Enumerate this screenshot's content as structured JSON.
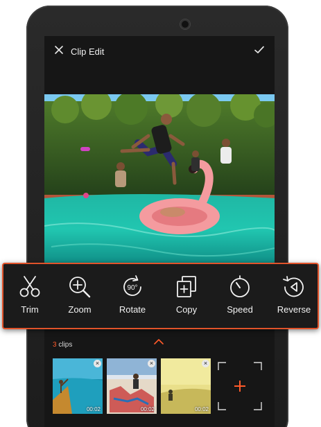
{
  "header": {
    "title": "Clip Edit",
    "close_icon": "close-icon",
    "confirm_icon": "checkmark-icon"
  },
  "toolbar": {
    "accent_color": "#e1532a",
    "items": [
      {
        "label": "Trim",
        "icon": "scissors-icon"
      },
      {
        "label": "Zoom",
        "icon": "zoom-in-icon"
      },
      {
        "label": "Rotate",
        "icon": "rotate-icon",
        "badge": "90°"
      },
      {
        "label": "Copy",
        "icon": "copy-icon"
      },
      {
        "label": "Speed",
        "icon": "speedometer-icon"
      },
      {
        "label": "Reverse",
        "icon": "reverse-icon"
      }
    ]
  },
  "clips": {
    "count": "3",
    "label": "clips",
    "items": [
      {
        "duration": "00:02",
        "thumb": "ocean-cliff"
      },
      {
        "duration": "00:02",
        "thumb": "graffiti-skater"
      },
      {
        "duration": "00:02",
        "thumb": "yellow-field"
      }
    ],
    "add_icon": "plus-icon"
  }
}
